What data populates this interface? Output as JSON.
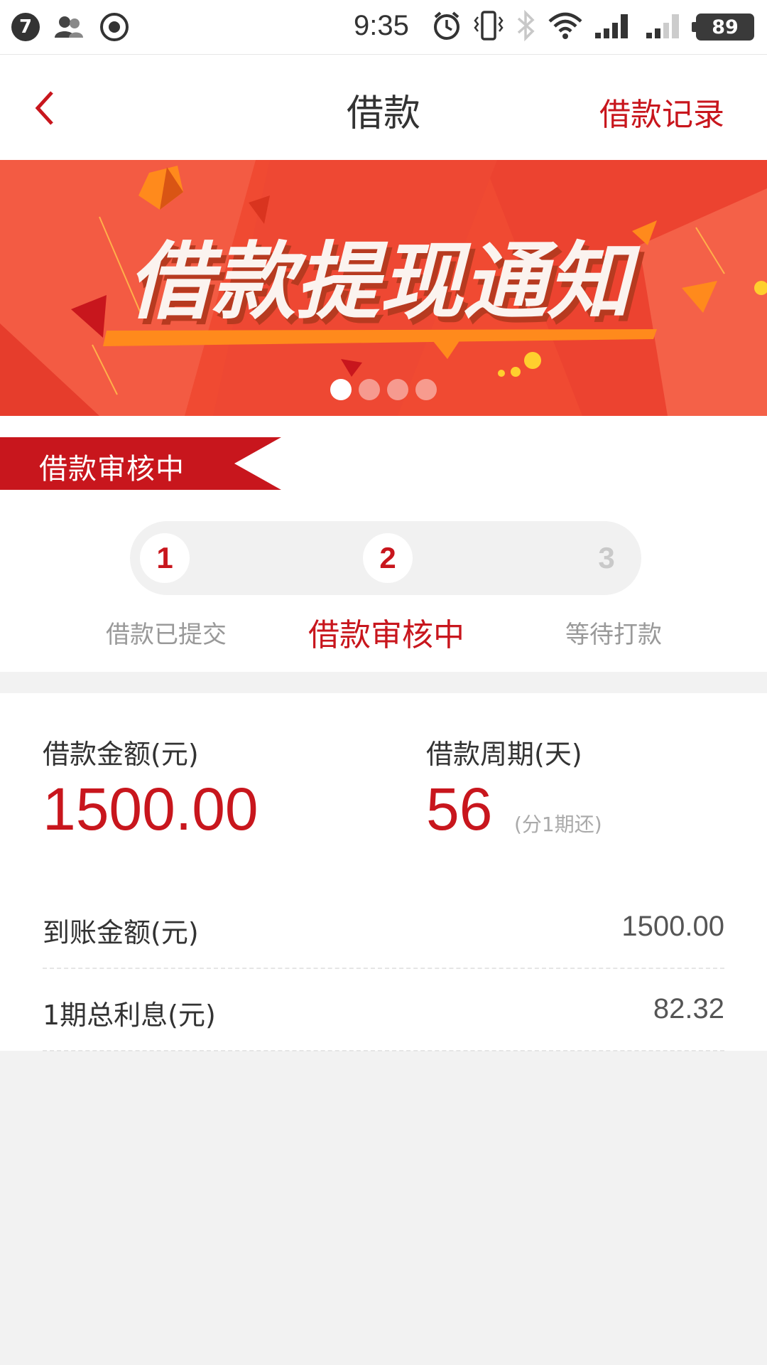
{
  "status_bar": {
    "notification_count": "7",
    "time": "9:35",
    "battery": "89",
    "icons": [
      "contacts-icon",
      "record-icon",
      "alarm-icon",
      "vibrate-icon",
      "bluetooth-icon",
      "wifi-icon",
      "signal-icon",
      "signal-weak-icon"
    ]
  },
  "header": {
    "title": "借款",
    "record_link": "借款记录",
    "back_icon": "back-arrow-icon"
  },
  "banner": {
    "headline": "借款提现通知",
    "slide_count": 4,
    "active_slide": 1
  },
  "progress": {
    "ribbon_label": "借款审核中",
    "steps": [
      {
        "number": "1",
        "label": "借款已提交",
        "state": "done"
      },
      {
        "number": "2",
        "label": "借款审核中",
        "state": "current"
      },
      {
        "number": "3",
        "label": "等待打款",
        "state": "pending"
      }
    ]
  },
  "details": {
    "amount_label": "借款金额(元)",
    "amount_value": "1500.00",
    "period_label": "借款周期(天)",
    "period_value": "56",
    "period_note": "(分1期还)",
    "rows": [
      {
        "label": "到账金额(元)",
        "value": "1500.00"
      },
      {
        "label": "1期总利息(元)",
        "value": "82.32"
      }
    ]
  },
  "colors": {
    "accent": "#c8161d",
    "banner_bg": "#f04a32",
    "page_bg": "#f2f2f2"
  }
}
